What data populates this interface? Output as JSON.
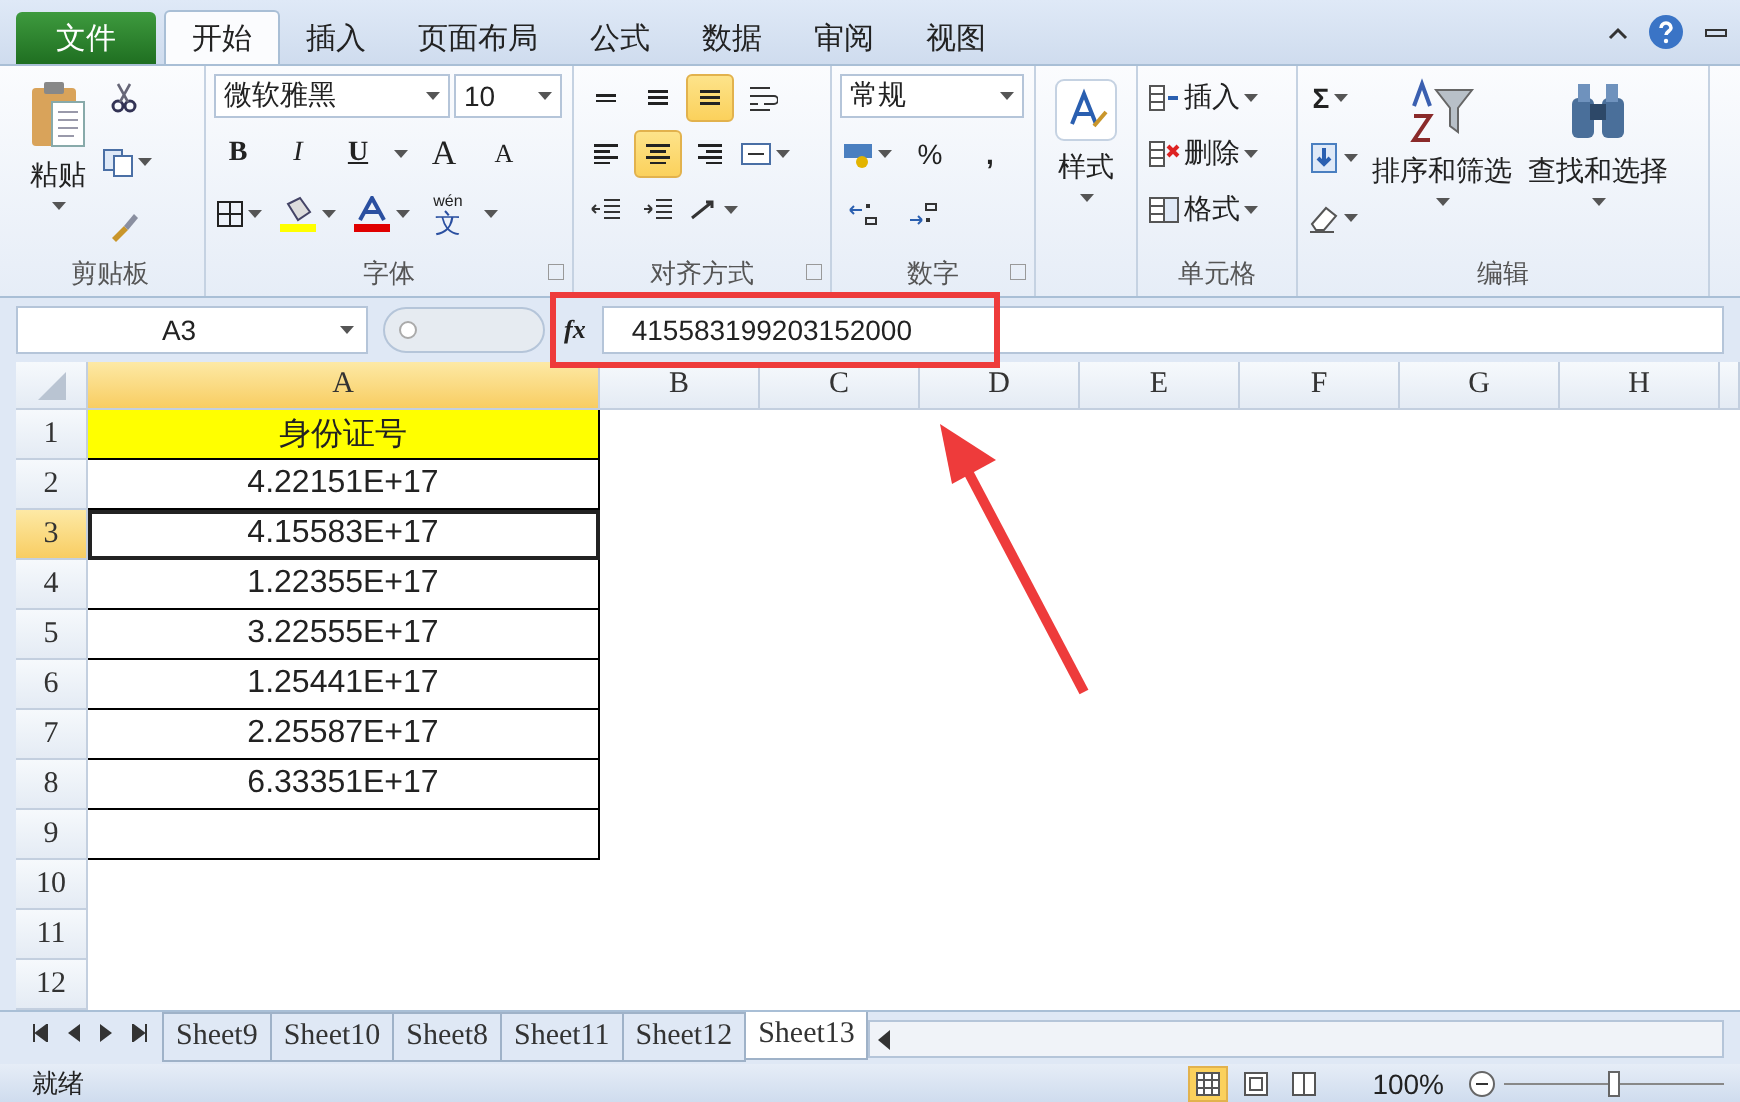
{
  "menu_tabs": [
    {
      "label": "文件",
      "kind": "file",
      "selected": false
    },
    {
      "label": "开始",
      "kind": "tab",
      "selected": true
    },
    {
      "label": "插入",
      "kind": "tab",
      "selected": false
    },
    {
      "label": "页面布局",
      "kind": "tab",
      "selected": false
    },
    {
      "label": "公式",
      "kind": "tab",
      "selected": false
    },
    {
      "label": "数据",
      "kind": "tab",
      "selected": false
    },
    {
      "label": "审阅",
      "kind": "tab",
      "selected": false
    },
    {
      "label": "视图",
      "kind": "tab",
      "selected": false
    }
  ],
  "ribbon": {
    "clipboard": {
      "label": "剪贴板",
      "paste": "粘贴"
    },
    "font": {
      "label": "字体",
      "font_name": "微软雅黑",
      "font_size": "10",
      "bold": "B",
      "italic": "I",
      "underline": "U",
      "grow": "A",
      "shrink": "A",
      "phonetic_top": "wén",
      "phonetic": "文"
    },
    "alignment": {
      "label": "对齐方式",
      "vertical": [
        {
          "selected": false
        },
        {
          "selected": false
        },
        {
          "selected": true
        }
      ],
      "horizontal": [
        {
          "selected": false
        },
        {
          "selected": true
        },
        {
          "selected": false
        }
      ]
    },
    "number": {
      "label": "数字",
      "format": "常规",
      "percent": "%",
      "comma": ","
    },
    "styles": {
      "label": "样式"
    },
    "cells": {
      "label": "单元格",
      "items": [
        "插入",
        "删除",
        "格式"
      ]
    },
    "editing": {
      "label": "编辑",
      "sum": "Σ",
      "sort": "排序和筛选",
      "find": "查找和选择"
    }
  },
  "formula_bar": {
    "name_box": "A3",
    "fx": "fx",
    "value": "415583199203152000"
  },
  "columns": [
    {
      "label": "A",
      "selected": true
    },
    {
      "label": "B",
      "selected": false
    },
    {
      "label": "C",
      "selected": false
    },
    {
      "label": "D",
      "selected": false
    },
    {
      "label": "E",
      "selected": false
    },
    {
      "label": "F",
      "selected": false
    },
    {
      "label": "G",
      "selected": false
    },
    {
      "label": "H",
      "selected": false
    }
  ],
  "rows": [
    {
      "number": "1",
      "value": "身份证号",
      "highlighted": true,
      "bordered": true,
      "selected": false
    },
    {
      "number": "2",
      "value": "4.22151E+17",
      "highlighted": false,
      "bordered": true,
      "selected": false
    },
    {
      "number": "3",
      "value": "4.15583E+17",
      "highlighted": false,
      "bordered": true,
      "selected": true
    },
    {
      "number": "4",
      "value": "1.22355E+17",
      "highlighted": false,
      "bordered": true,
      "selected": false
    },
    {
      "number": "5",
      "value": "3.22555E+17",
      "highlighted": false,
      "bordered": true,
      "selected": false
    },
    {
      "number": "6",
      "value": "1.25441E+17",
      "highlighted": false,
      "bordered": true,
      "selected": false
    },
    {
      "number": "7",
      "value": "2.25587E+17",
      "highlighted": false,
      "bordered": true,
      "selected": false
    },
    {
      "number": "8",
      "value": "6.33351E+17",
      "highlighted": false,
      "bordered": true,
      "selected": false
    },
    {
      "number": "9",
      "highlighted": false,
      "bordered": true,
      "selected": false
    },
    {
      "number": "10",
      "highlighted": false,
      "bordered": false,
      "selected": false
    },
    {
      "number": "11",
      "highlighted": false,
      "bordered": false,
      "selected": false
    },
    {
      "number": "12",
      "highlighted": false,
      "bordered": false,
      "selected": false
    }
  ],
  "sheet_tabs": [
    {
      "label": "Sheet9",
      "selected": false
    },
    {
      "label": "Sheet10",
      "selected": false
    },
    {
      "label": "Sheet8",
      "selected": false
    },
    {
      "label": "Sheet11",
      "selected": false
    },
    {
      "label": "Sheet12",
      "selected": false
    },
    {
      "label": "Sheet13",
      "selected": true
    }
  ],
  "status_bar": {
    "text": "就绪",
    "views": [
      {
        "selected": true
      },
      {
        "selected": false
      },
      {
        "selected": false
      }
    ],
    "zoom": "100%",
    "zoom_slider": {
      "level": 0.5
    }
  }
}
